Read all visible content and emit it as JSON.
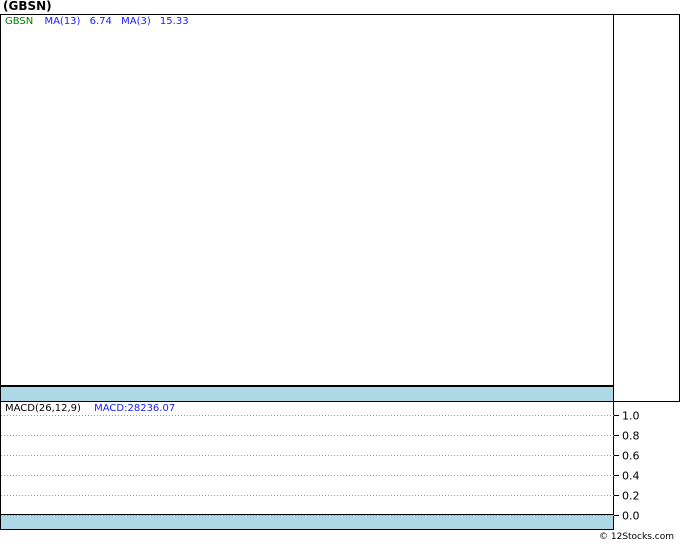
{
  "title": "(GBSN)",
  "price_legend": {
    "symbol": "GBSN",
    "ma13_label": "MA(13)",
    "ma13_value": "6.74",
    "ma3_label": "MA(3)",
    "ma3_value": "15.33"
  },
  "macd_legend": {
    "label": "MACD(26,12,9)",
    "value_text": "MACD:28236.07"
  },
  "footer": "© 12Stocks.com",
  "colors": {
    "strip": "#add8e6",
    "symbol": "#008000",
    "ma": "#1a1aff",
    "grid": "#999999"
  },
  "chart_data": {
    "type": "line",
    "title": "(GBSN)",
    "panels": [
      {
        "name": "price",
        "series": [
          {
            "name": "MA(13)",
            "values": []
          },
          {
            "name": "MA(3)",
            "values": []
          }
        ]
      },
      {
        "name": "macd",
        "ylim": [
          0.0,
          1.0
        ],
        "yticks": [
          "1.0",
          "0.8",
          "0.6",
          "0.4",
          "0.2",
          "0.0"
        ],
        "yticks_values": [
          1.0,
          0.8,
          0.6,
          0.4,
          0.2,
          0.0
        ],
        "grid": "dotted",
        "series": [
          {
            "name": "MACD",
            "values": []
          }
        ]
      }
    ]
  }
}
